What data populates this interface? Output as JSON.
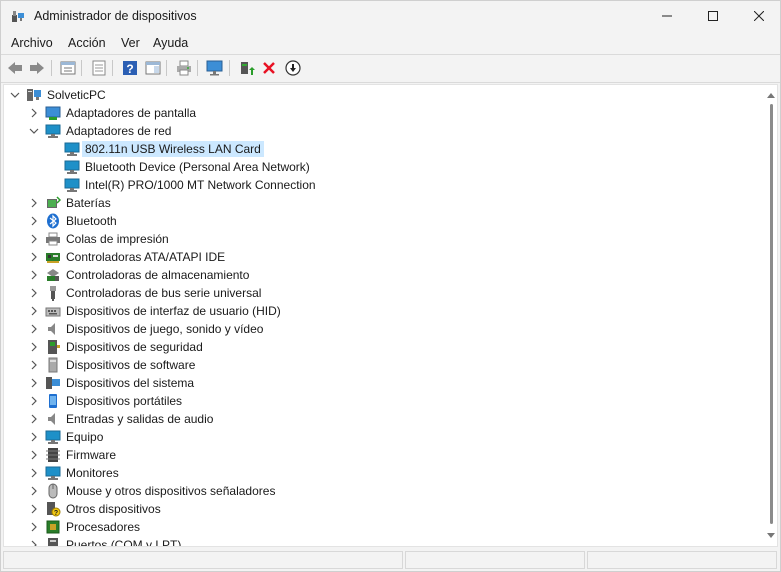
{
  "window": {
    "title": "Administrador de dispositivos"
  },
  "menu": [
    "Archivo",
    "Acción",
    "Ver",
    "Ayuda"
  ],
  "toolbar": {
    "buttons": [
      "back-icon",
      "forward-icon",
      "properties-list-icon",
      "show-hidden-icon",
      "help-icon",
      "action-pane-icon",
      "print-icon",
      "scan-hardware-icon",
      "update-driver-icon",
      "uninstall-icon",
      "disable-icon"
    ]
  },
  "tree": {
    "root": "SolveticPC",
    "items": [
      {
        "label": "Adaptadores de pantalla",
        "expanded": false
      },
      {
        "label": "Adaptadores de red",
        "expanded": true,
        "children": [
          {
            "label": "802.11n USB Wireless LAN Card",
            "selected": true
          },
          {
            "label": "Bluetooth Device (Personal Area Network)"
          },
          {
            "label": "Intel(R) PRO/1000 MT Network Connection"
          }
        ]
      },
      {
        "label": "Baterías",
        "expanded": false
      },
      {
        "label": "Bluetooth",
        "expanded": false
      },
      {
        "label": "Colas de impresión",
        "expanded": false
      },
      {
        "label": "Controladoras ATA/ATAPI IDE",
        "expanded": false
      },
      {
        "label": "Controladoras de almacenamiento",
        "expanded": false
      },
      {
        "label": "Controladoras de bus serie universal",
        "expanded": false
      },
      {
        "label": "Dispositivos de interfaz de usuario (HID)",
        "expanded": false
      },
      {
        "label": "Dispositivos de juego, sonido y vídeo",
        "expanded": false
      },
      {
        "label": "Dispositivos de seguridad",
        "expanded": false
      },
      {
        "label": "Dispositivos de software",
        "expanded": false
      },
      {
        "label": "Dispositivos del sistema",
        "expanded": false
      },
      {
        "label": "Dispositivos portátiles",
        "expanded": false
      },
      {
        "label": "Entradas y salidas de audio",
        "expanded": false
      },
      {
        "label": "Equipo",
        "expanded": false
      },
      {
        "label": "Firmware",
        "expanded": false
      },
      {
        "label": "Monitores",
        "expanded": false
      },
      {
        "label": "Mouse y otros dispositivos señaladores",
        "expanded": false
      },
      {
        "label": "Otros dispositivos",
        "expanded": false
      },
      {
        "label": "Procesadores",
        "expanded": false
      },
      {
        "label": "Puertos (COM y LPT)",
        "expanded": false
      }
    ]
  },
  "colors": {
    "selection": "#cce8ff",
    "network": "#1e90c8",
    "uninstall_red": "#e81123"
  }
}
